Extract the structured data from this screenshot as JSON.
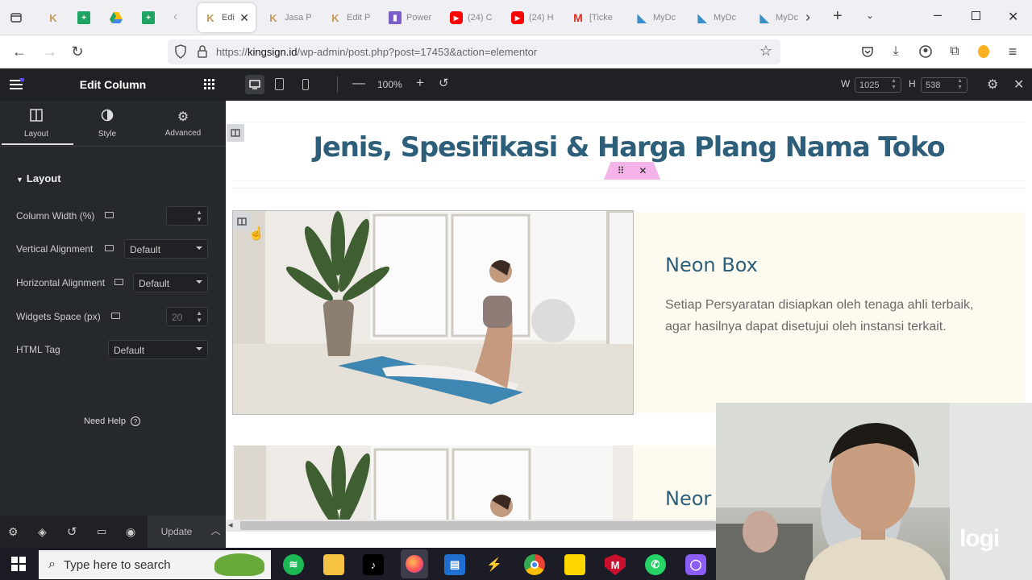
{
  "browser": {
    "tabs": [
      {
        "label": "Edi",
        "icon": "elementor-k-icon",
        "active": true
      },
      {
        "label": "Jasa P",
        "icon": "elementor-k-icon"
      },
      {
        "label": "Edit P",
        "icon": "elementor-k-icon"
      },
      {
        "label": "Power",
        "icon": "powerbi-icon"
      },
      {
        "label": "(24) C",
        "icon": "youtube-icon"
      },
      {
        "label": "(24) H",
        "icon": "youtube-icon"
      },
      {
        "label": "[Ticke",
        "icon": "gmail-icon"
      },
      {
        "label": "MyDc",
        "icon": "mydc-icon"
      },
      {
        "label": "MyDc",
        "icon": "mydc-icon"
      },
      {
        "label": "MyDc",
        "icon": "mydc-icon"
      }
    ],
    "url_prefix": "https://",
    "url_domain": "kingsign.id",
    "url_path": "/wp-admin/post.php?post=17453&action=elementor"
  },
  "panel": {
    "title": "Edit Column",
    "tabs": [
      {
        "label": "Layout",
        "icon": "columns-icon"
      },
      {
        "label": "Style",
        "icon": "half-circle-icon"
      },
      {
        "label": "Advanced",
        "icon": "gear-icon"
      }
    ],
    "section_title": "Layout",
    "controls": {
      "column_width_label": "Column Width (%)",
      "vertical_alignment_label": "Vertical Alignment",
      "vertical_alignment_value": "Default",
      "horizontal_alignment_label": "Horizontal Alignment",
      "horizontal_alignment_value": "Default",
      "widgets_space_label": "Widgets Space (px)",
      "widgets_space_placeholder": "20",
      "html_tag_label": "HTML Tag",
      "html_tag_value": "Default"
    },
    "need_help": "Need Help",
    "update_label": "Update"
  },
  "topbar": {
    "zoom": "100%",
    "width_label": "W",
    "width_value": "1025",
    "height_label": "H",
    "height_value": "538"
  },
  "canvas": {
    "heading": "Jenis, Spesifikasi & Harga Plang Nama Toko",
    "card1_title": "Neon Box",
    "card1_desc": "Setiap Persyaratan disiapkan oleh tenaga ahli terbaik, agar hasilnya dapat disetujui oleh instansi terkait.",
    "card2_title": "Neor"
  },
  "taskbar": {
    "search_placeholder": "Type here to search"
  },
  "webcam": {
    "logo": "logi"
  }
}
